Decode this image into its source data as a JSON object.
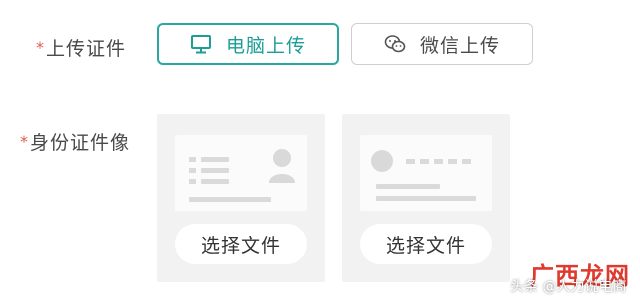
{
  "upload_cert": {
    "required_mark": "*",
    "label": "上传证件",
    "pc_upload_label": "电脑上传",
    "wechat_upload_label": "微信上传",
    "active_color": "#2aa7a0"
  },
  "id_photo": {
    "required_mark": "*",
    "label": "身份证件像",
    "cards": [
      {
        "side": "front",
        "button_label": "选择文件"
      },
      {
        "side": "back",
        "button_label": "选择文件"
      }
    ]
  },
  "watermark": {
    "logo_text": "广西龙网",
    "caption": "头条 @人力说电商"
  }
}
